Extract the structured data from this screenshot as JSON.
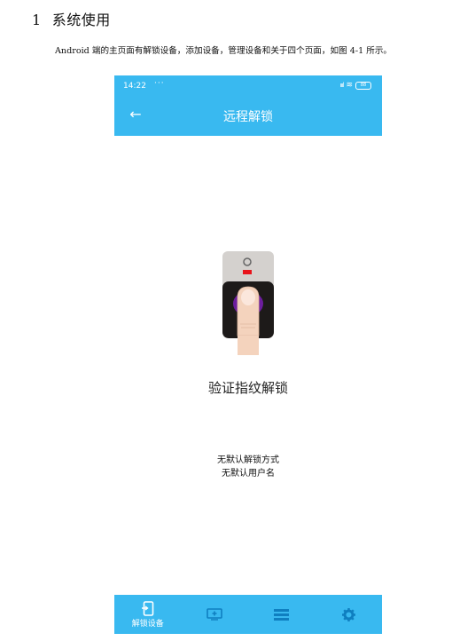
{
  "document": {
    "heading_number": "1",
    "heading_text": "系统使用",
    "paragraph": "Android 端的主页面有解锁设备，添加设备，管理设备和关于四个页面，如图 4-1 所示。"
  },
  "phone": {
    "status_bar": {
      "time": "14:22",
      "dots": "···",
      "signal": "ıııl",
      "wifi": "≋",
      "battery": "88"
    },
    "app_bar": {
      "back_glyph": "←",
      "title": "远程解锁"
    },
    "main": {
      "fingerprint_icon": "fingerprint-scanner-icon",
      "verify_title": "验证指纹解锁",
      "info_lines": [
        "无默认解锁方式",
        "无默认用户名"
      ]
    },
    "bottom_nav": {
      "items": [
        {
          "label": "解锁设备",
          "icon": "phone-unlock-icon"
        },
        {
          "label": "",
          "icon": "add-device-icon"
        },
        {
          "label": "",
          "icon": "list-icon"
        },
        {
          "label": "",
          "icon": "gear-icon"
        }
      ]
    }
  },
  "colors": {
    "accent": "#39b9f0",
    "nav_active": "#ffffff",
    "nav_inactive": "#0f7fc0"
  }
}
